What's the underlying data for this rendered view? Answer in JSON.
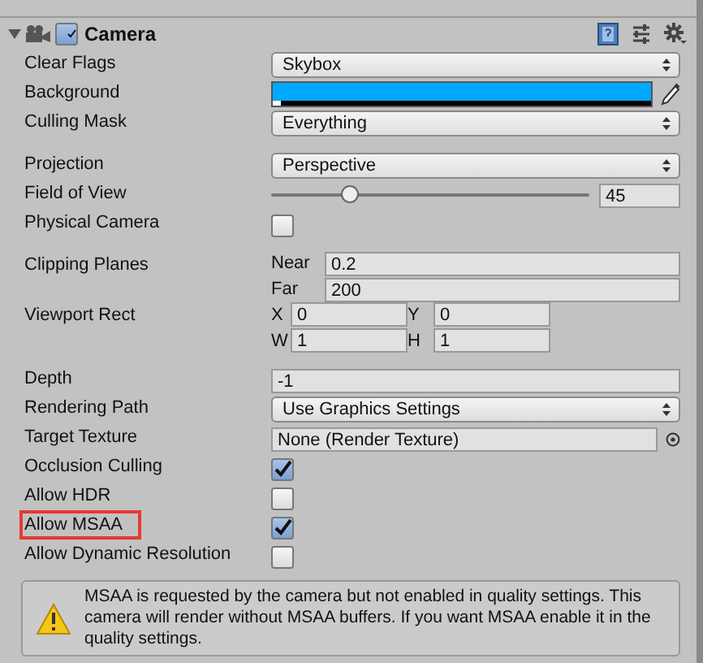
{
  "component": {
    "title": "Camera",
    "enabled": true,
    "expanded": true
  },
  "groups": [
    [
      {
        "kind": "dropdown",
        "label": "Clear Flags",
        "value": "Skybox",
        "highlighted": false
      },
      {
        "kind": "color",
        "label": "Background",
        "color": "#00a8ff",
        "highlighted": false
      },
      {
        "kind": "dropdown",
        "label": "Culling Mask",
        "value": "Everything",
        "highlighted": false
      }
    ],
    [
      {
        "kind": "dropdown",
        "label": "Projection",
        "value": "Perspective",
        "highlighted": false
      },
      {
        "kind": "slider",
        "label": "Field of View",
        "level": 0.25,
        "value": "45",
        "highlighted": false
      },
      {
        "kind": "checkbox",
        "label": "Physical Camera",
        "checked": false,
        "highlighted": false
      }
    ],
    [
      {
        "kind": "pair",
        "label": "Clipping Planes",
        "fields": [
          {
            "label": "Near",
            "value": "0.2"
          },
          {
            "label": "Far",
            "value": "200"
          }
        ],
        "highlighted": false
      },
      {
        "kind": "rect",
        "label": "Viewport Rect",
        "fields": [
          {
            "label": "X",
            "value": "0"
          },
          {
            "label": "Y",
            "value": "0"
          },
          {
            "label": "W",
            "value": "1"
          },
          {
            "label": "H",
            "value": "1"
          }
        ],
        "highlighted": false
      }
    ],
    [
      {
        "kind": "number",
        "label": "Depth",
        "value": "-1",
        "highlighted": false
      },
      {
        "kind": "dropdown",
        "label": "Rendering Path",
        "value": "Use Graphics Settings",
        "highlighted": false
      },
      {
        "kind": "object",
        "label": "Target Texture",
        "value": "None (Render Texture)",
        "highlighted": false
      },
      {
        "kind": "checkbox",
        "label": "Occlusion Culling",
        "checked": true,
        "highlighted": false
      },
      {
        "kind": "checkbox",
        "label": "Allow HDR",
        "checked": false,
        "highlighted": false
      },
      {
        "kind": "checkbox",
        "label": "Allow MSAA",
        "checked": true,
        "highlighted": true
      },
      {
        "kind": "checkbox",
        "label": "Allow Dynamic Resolution",
        "checked": false,
        "highlighted": false
      }
    ]
  ],
  "warning": "MSAA is requested by the camera but not enabled in quality settings. This camera will render without MSAA buffers. If you want MSAA enable it in the quality settings."
}
